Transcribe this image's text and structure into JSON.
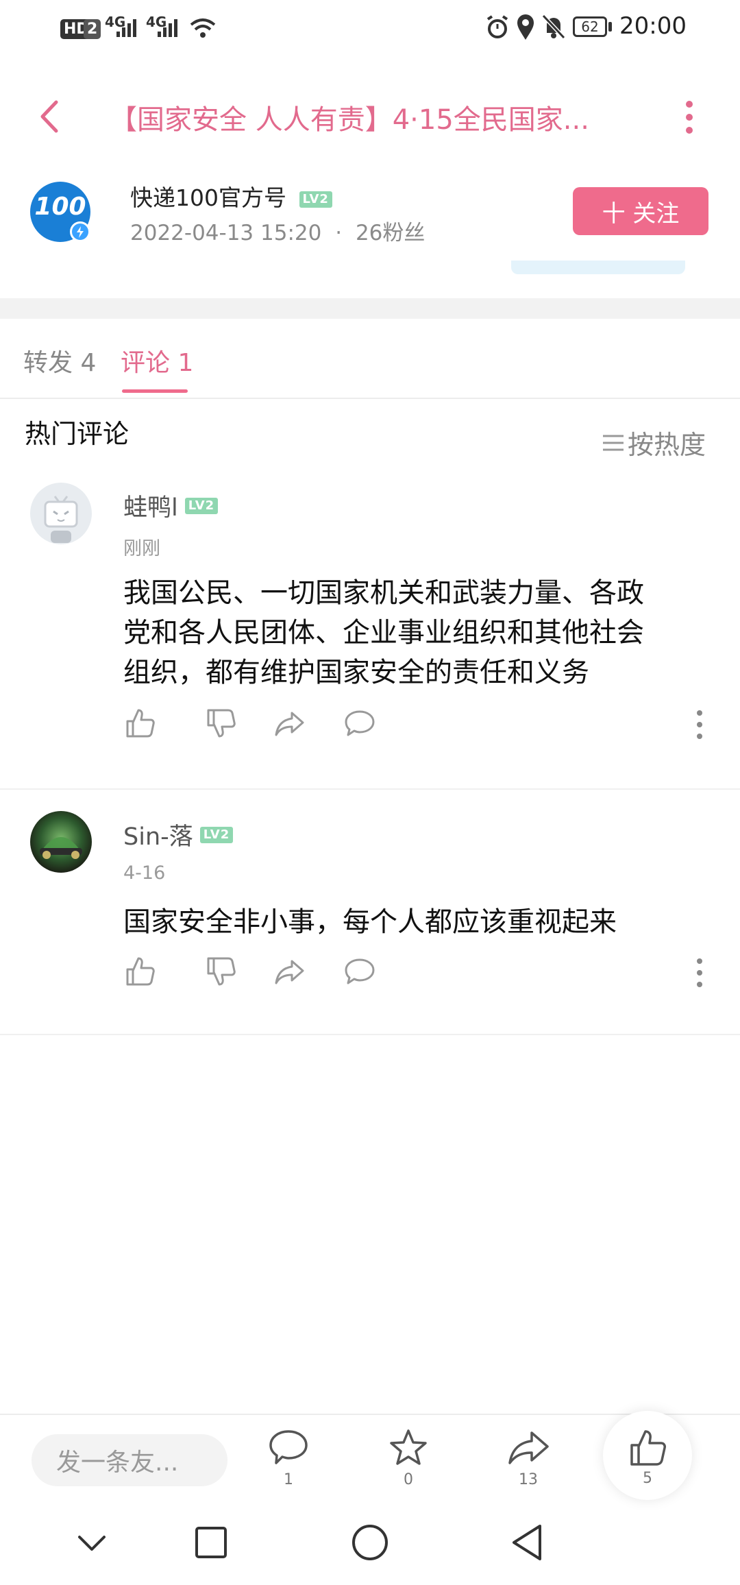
{
  "status_bar": {
    "hd": "HD",
    "sim": "2",
    "net1": "4G",
    "net2": "4G",
    "battery": "62",
    "time": "20:00"
  },
  "header": {
    "title": "【国家安全 人人有责】4·15全民国家...",
    "back_icon": "chevron-left-icon",
    "more_icon": "more-vertical-icon"
  },
  "author": {
    "avatar_text": "100",
    "name": "快递100官方号",
    "level": "LV2",
    "time": "2022-04-13 15:20",
    "sep": "·",
    "fans": "26粉丝",
    "follow_label": "十 关注"
  },
  "tabs": [
    {
      "label": "转发 4"
    },
    {
      "label": "评论 1"
    }
  ],
  "hot": {
    "title": "热门评论",
    "sort_label": "按热度"
  },
  "comments": [
    {
      "name": "蛙鸭l",
      "level": "LV2",
      "time": "刚刚",
      "lines": [
        "我国公民、一切国家机关和武装力量、各政",
        "党和各人民团体、企业事业组织和其他社会",
        "组织，都有维护国家安全的责任和义务"
      ]
    },
    {
      "name": "Sin-落",
      "level": "LV2",
      "time": "4-16",
      "lines": [
        "国家安全非小事，每个人都应该重视起来"
      ]
    }
  ],
  "bottom_bar": {
    "input_placeholder": "发一条友...",
    "comment_count": "1",
    "star_count": "0",
    "share_count": "13",
    "like_count": "5"
  },
  "colors": {
    "accent": "#ef6b8c",
    "title_pink": "#e26a8d",
    "level_green": "#8fd7b0"
  }
}
